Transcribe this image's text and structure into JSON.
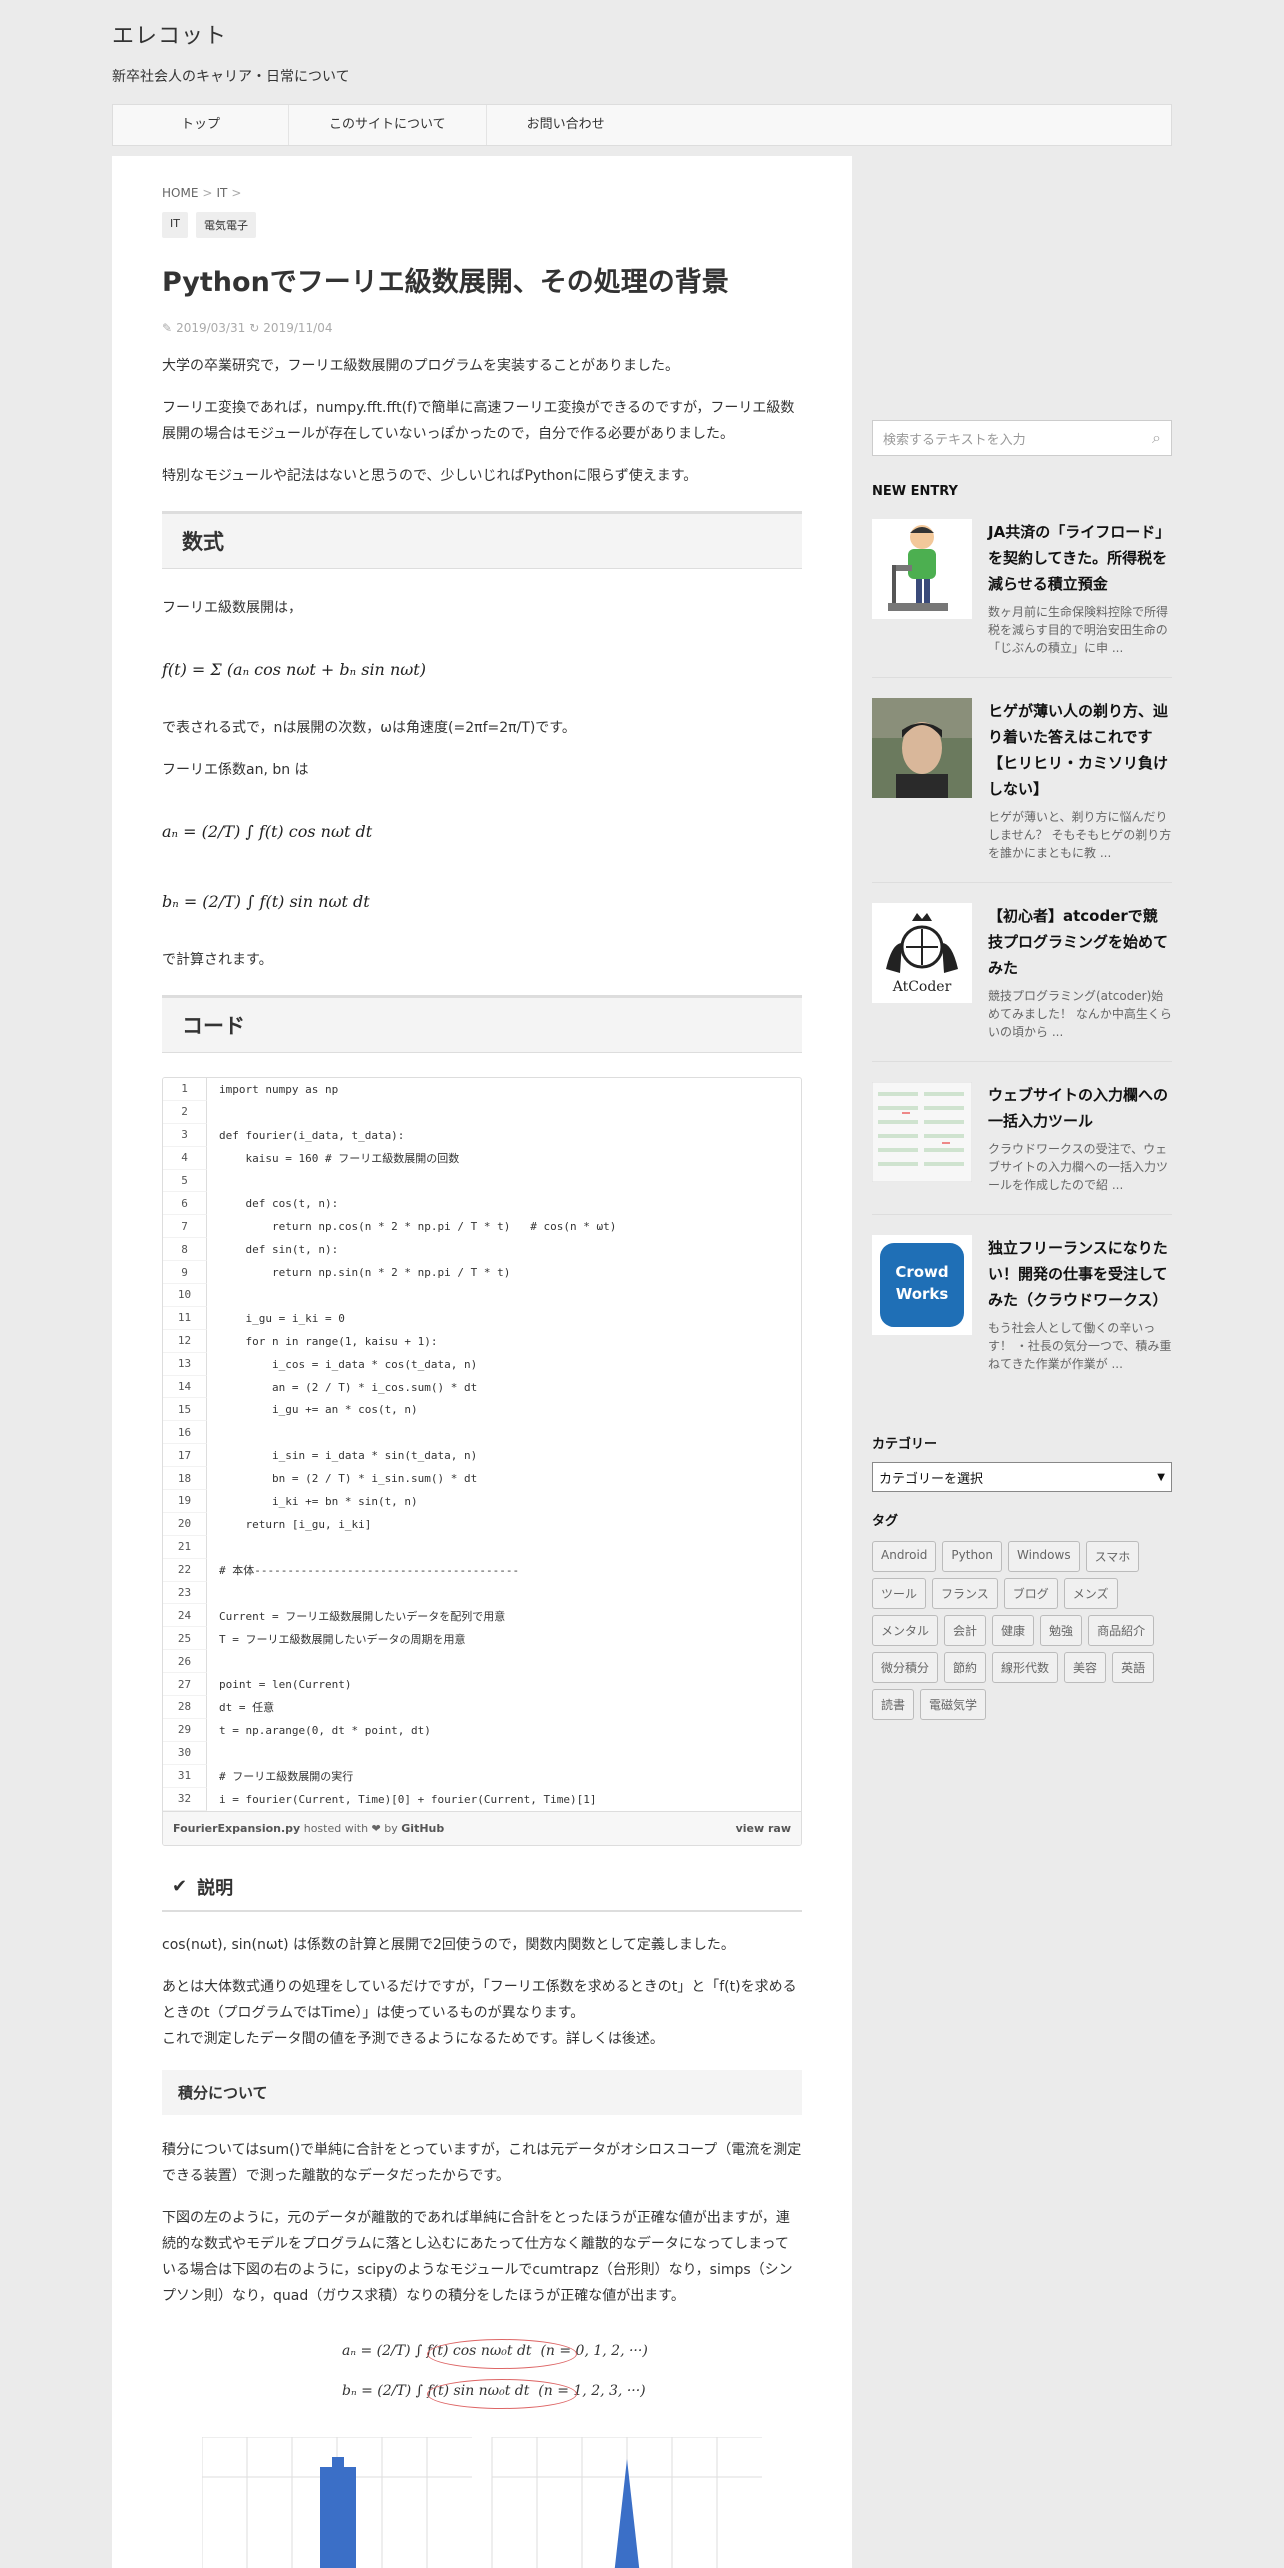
{
  "site": {
    "title": "エレコット",
    "desc": "新卒社会人のキャリア・日常について"
  },
  "nav": [
    "トップ",
    "このサイトについて",
    "お問い合わせ"
  ],
  "breadcrumb": {
    "home": "HOME",
    "cat": "IT"
  },
  "tags_top": [
    "IT",
    "電気電子"
  ],
  "article": {
    "title": "Pythonでフーリエ級数展開、その処理の背景",
    "date_posted": "2019/03/31",
    "date_updated": "2019/11/04",
    "p1": "大学の卒業研究で，フーリエ級数展開のプログラムを実装することがありました。",
    "p2": "フーリエ変換であれば，numpy.fft.fft(f)で簡単に高速フーリエ変換ができるのですが，フーリエ級数展開の場合はモジュールが存在していないっぽかったので，自分で作る必要がありました。",
    "p3": "特別なモジュールや記法はないと思うので、少しいじればPythonに限らず使えます。",
    "h_formula": "数式",
    "p4": "フーリエ級数展開は，",
    "f1": "f(t) = Σ (aₙ cos nωt + bₙ sin nωt)",
    "p5": "で表される式で，nは展開の次数，ωは角速度(=2πf=2π/T)です。",
    "p6": "フーリエ係数an, bn は",
    "f2": "aₙ = (2/T) ∫ f(t) cos nωt dt",
    "f3": "bₙ = (2/T) ∫ f(t) sin nωt dt",
    "p7": "で計算されます。",
    "h_code": "コード",
    "gist_file": "FourierExpansion.py",
    "gist_hosted": "hosted with ❤ by",
    "gist_github": "GitHub",
    "gist_raw": "view raw",
    "h_explain": "説明",
    "p8": "cos(nωt), sin(nωt) は係数の計算と展開で2回使うので，関数内関数として定義しました。",
    "p9": "あとは大体数式通りの処理をしているだけですが，「フーリエ係数を求めるときのt」と「f(t)を求めるときのt（プログラムではTime）」は使っているものが異なります。",
    "p9b": "これで測定したデータ間の値を予測できるようになるためです。詳しくは後述。",
    "h_integral": "積分について",
    "p10": "積分についてはsum()で単純に合計をとっていますが，これは元データがオシロスコープ（電流を測定できる装置）で測った離散的なデータだったからです。",
    "p11": "下図の左のように，元のデータが離散的であれば単純に合計をとったほうが正確な値が出ますが，連続的な数式やモデルをプログラムに落とし込むにあたって仕方なく離散的なデータになってしまっている場合は下図の右のように，scipyのようなモジュールでcumtrapz（台形則）なり，simps（シンプソン則）なり，quad（ガウス求積）なりの積分をしたほうが正確な値が出ます。",
    "fig_a": "aₙ = (2/T) ∫ f(t) cos nω₀t dt",
    "fig_a_n": "(n = 0, 1, 2, ···)",
    "fig_b": "bₙ = (2/T) ∫ f(t) sin nω₀t dt",
    "fig_b_n": "(n = 1, 2, 3, ···)"
  },
  "code": [
    "import numpy as np",
    "",
    "def fourier(i_data, t_data):",
    "    kaisu = 160 # フーリエ級数展開の回数",
    "",
    "    def cos(t, n):",
    "        return np.cos(n * 2 * np.pi / T * t)   # cos(n * ωt)",
    "    def sin(t, n):",
    "        return np.sin(n * 2 * np.pi / T * t)",
    "",
    "    i_gu = i_ki = 0",
    "    for n in range(1, kaisu + 1):",
    "        i_cos = i_data * cos(t_data, n)",
    "        an = (2 / T) * i_cos.sum() * dt",
    "        i_gu += an * cos(t, n)",
    "",
    "        i_sin = i_data * sin(t_data, n)",
    "        bn = (2 / T) * i_sin.sum() * dt",
    "        i_ki += bn * sin(t, n)",
    "    return [i_gu, i_ki]",
    "",
    "# 本体----------------------------------------",
    "",
    "Current = フーリエ級数展開したいデータを配列で用意",
    "T = フーリエ級数展開したいデータの周期を用意",
    "",
    "point = len(Current)",
    "dt = 任意",
    "t = np.arange(0, dt * point, dt)",
    "",
    "# フーリエ級数展開の実行",
    "i = fourier(Current, Time)[0] + fourier(Current, Time)[1]"
  ],
  "sidebar": {
    "search_placeholder": "検索するテキストを入力",
    "new_entry": "NEW ENTRY",
    "entries": [
      {
        "title": "JA共済の「ライフロード」を契約してきた。所得税を減らせる積立預金",
        "excerpt": "数ヶ月前に生命保険料控除で所得税を減らす目的で明治安田生命の「じぶんの積立」に申 ..."
      },
      {
        "title": "ヒゲが薄い人の剃り方、辿り着いた答えはこれです【ヒリヒリ・カミソリ負けしない】",
        "excerpt": "ヒゲが薄いと、剃り方に悩んだりしません？ そもそもヒゲの剃り方を誰かにまともに教 ..."
      },
      {
        "title": "【初心者】atcoderで競技プログラミングを始めてみた",
        "excerpt": "競技プログラミング(atcoder)始めてみました！ なんか中高生くらいの頃から ..."
      },
      {
        "title": "ウェブサイトの入力欄への一括入力ツール",
        "excerpt": "クラウドワークスの受注で、ウェブサイトの入力欄への一括入力ツールを作成したので紹 ..."
      },
      {
        "title": "独立フリーランスになりたい！開発の仕事を受注してみた（クラウドワークス）",
        "excerpt": "もう社会人として働くの辛いっす！ ・社長の気分一つで、積み重ねてきた作業が作業が ..."
      }
    ],
    "atcoder_logo": "AtCoder",
    "crowdworks_logo": "Crowd Works",
    "category_h": "カテゴリー",
    "category_select": "カテゴリーを選択",
    "tag_h": "タグ",
    "tags": [
      "Android",
      "Python",
      "Windows",
      "スマホ",
      "ツール",
      "フランス",
      "ブログ",
      "メンズ",
      "メンタル",
      "会計",
      "健康",
      "勉強",
      "商品紹介",
      "微分積分",
      "節約",
      "線形代数",
      "美容",
      "英語",
      "読書",
      "電磁気学"
    ]
  }
}
